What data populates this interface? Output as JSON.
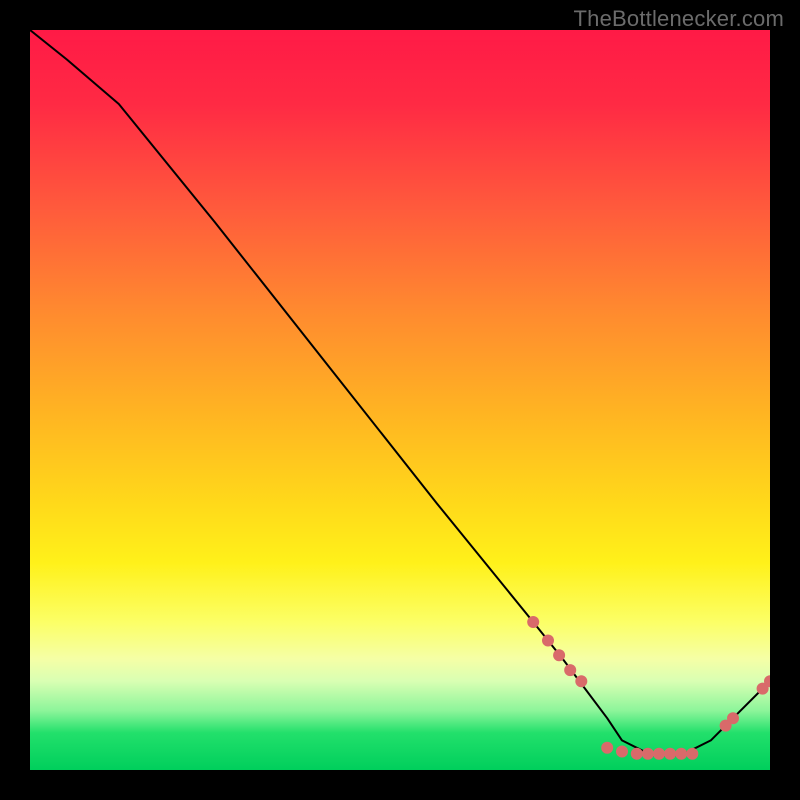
{
  "watermark": "TheBottlenecker.com",
  "chart_data": {
    "type": "line",
    "title": "",
    "xlabel": "",
    "ylabel": "",
    "xlim": [
      0,
      100
    ],
    "ylim": [
      0,
      100
    ],
    "grid": false,
    "background": "gradient-red-to-green-vertical",
    "series": [
      {
        "name": "curve",
        "x": [
          0,
          5,
          12,
          25,
          40,
          55,
          68,
          72,
          75,
          78,
          80,
          84,
          88,
          92,
          95,
          100
        ],
        "y": [
          100,
          96,
          90,
          74,
          55,
          36,
          20,
          15,
          11,
          7,
          4,
          2,
          2,
          4,
          7,
          12
        ],
        "stroke": "#000000"
      }
    ],
    "markers": {
      "name": "dots",
      "color": "#d96a6a",
      "x": [
        68,
        70,
        71.5,
        73,
        74.5,
        78,
        80,
        82,
        83.5,
        85,
        86.5,
        88,
        89.5,
        94,
        95,
        99,
        100
      ],
      "y": [
        20,
        17.5,
        15.5,
        13.5,
        12,
        3,
        2.5,
        2.2,
        2.2,
        2.2,
        2.2,
        2.2,
        2.2,
        6,
        7,
        11,
        12
      ]
    }
  }
}
